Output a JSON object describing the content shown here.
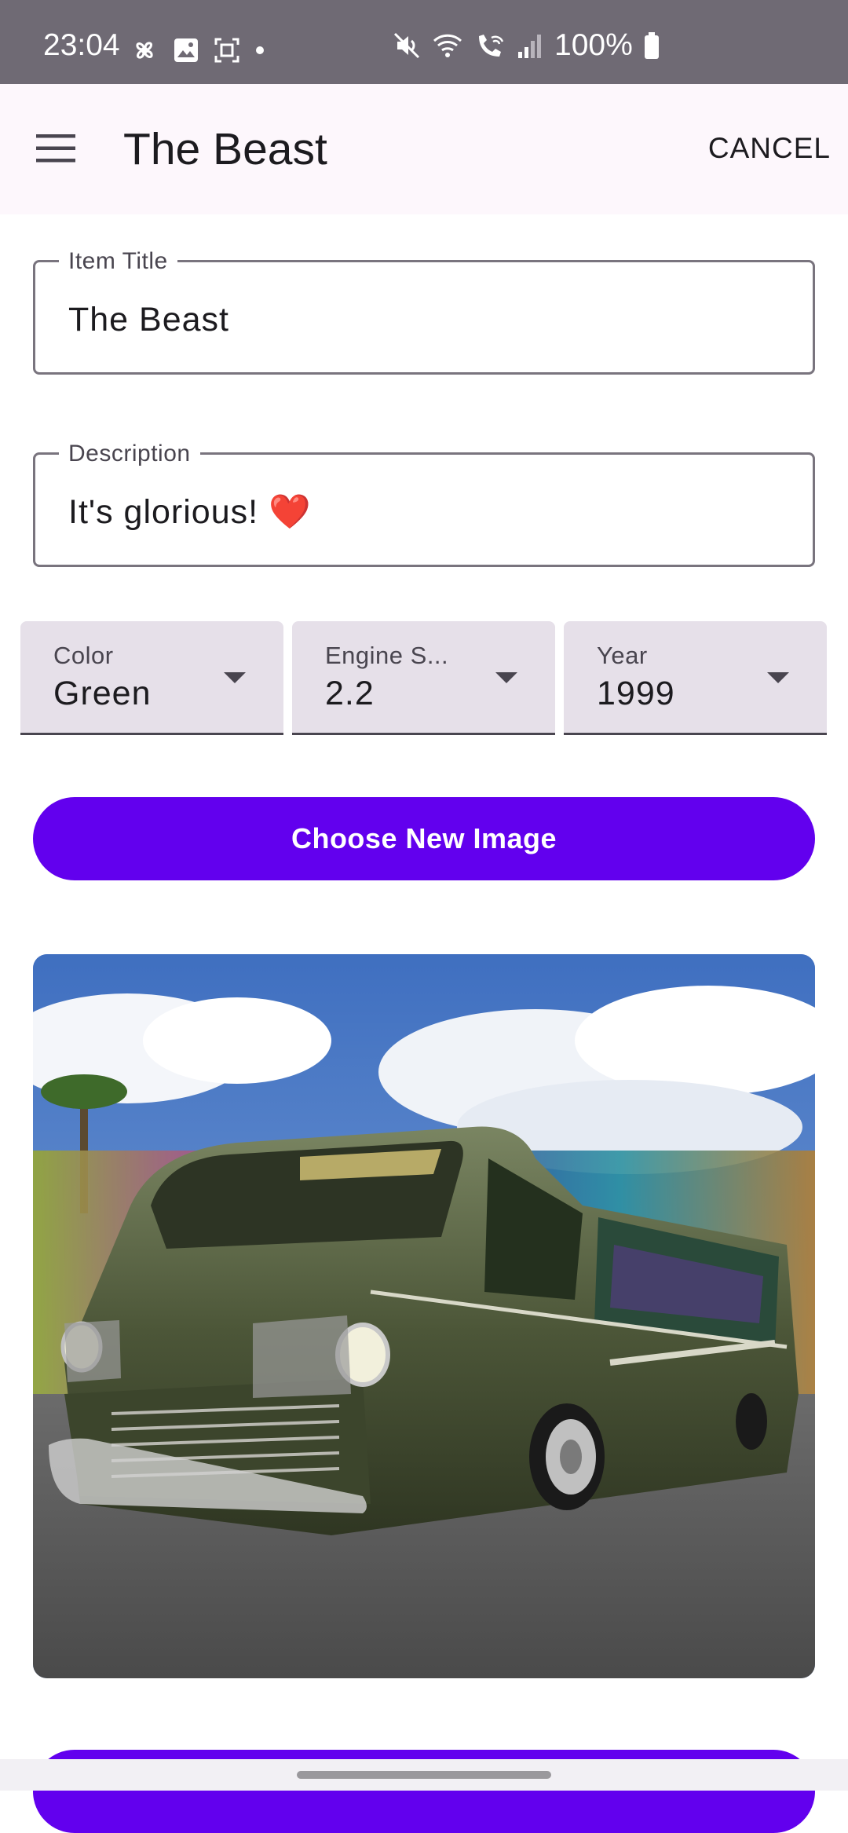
{
  "status_bar": {
    "time": "23:04",
    "battery": "100%",
    "left_icons": [
      "fan-icon",
      "gallery-icon",
      "screenshot-icon",
      "dot-icon"
    ],
    "right_icons": [
      "mute-icon",
      "wifi-icon",
      "wifi-calling-icon",
      "signal-icon",
      "battery-icon"
    ]
  },
  "app_bar": {
    "title": "The Beast",
    "cancel_label": "CANCEL",
    "menu_icon": "hamburger-menu-icon"
  },
  "form": {
    "item_title": {
      "label": "Item Title",
      "value": "The Beast"
    },
    "description": {
      "label": "Description",
      "value": "It's glorious!",
      "emoji": "❤️"
    },
    "dropdowns": [
      {
        "label": "Color",
        "value": "Green"
      },
      {
        "label": "Engine S...",
        "value": "2.2"
      },
      {
        "label": "Year",
        "value": "1999"
      }
    ],
    "choose_image_label": "Choose New Image"
  },
  "colors": {
    "primary": "#6200ee",
    "status_bar": "#6f6a74",
    "app_bar": "#fdf7fc",
    "dropdown_fill": "#e6e0e9",
    "outline": "#79747e"
  }
}
